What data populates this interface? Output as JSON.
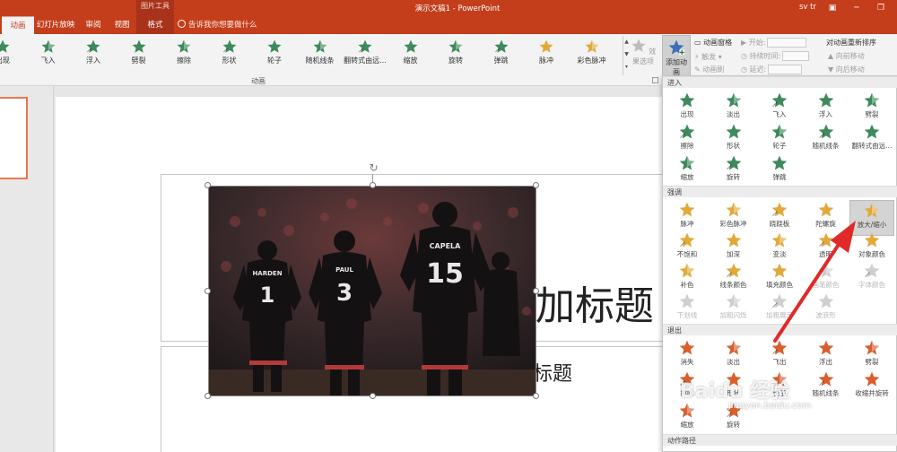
{
  "window": {
    "title": "演示文稿1 - PowerPoint",
    "context_group": "图片工具",
    "user": "sv tr"
  },
  "tabs": [
    {
      "label": "动画",
      "active": true
    },
    {
      "label": "幻灯片放映"
    },
    {
      "label": "审阅"
    },
    {
      "label": "视图"
    },
    {
      "label": "格式",
      "contextual": true
    }
  ],
  "tell_me": "告诉我你想要做什么",
  "ribbon": {
    "gallery": [
      {
        "label": "出现",
        "color": "#3e8a5c"
      },
      {
        "label": "飞入",
        "color": "#3e8a5c"
      },
      {
        "label": "浮入",
        "color": "#3e8a5c"
      },
      {
        "label": "劈裂",
        "color": "#3e8a5c"
      },
      {
        "label": "擦除",
        "color": "#3e8a5c"
      },
      {
        "label": "形状",
        "color": "#3e8a5c"
      },
      {
        "label": "轮子",
        "color": "#3e8a5c"
      },
      {
        "label": "随机线条",
        "color": "#3e8a5c"
      },
      {
        "label": "翻转式由远...",
        "color": "#3e8a5c"
      },
      {
        "label": "缩放",
        "color": "#3e8a5c"
      },
      {
        "label": "旋转",
        "color": "#3e8a5c"
      },
      {
        "label": "弹跳",
        "color": "#3e8a5c"
      },
      {
        "label": "脉冲",
        "color": "#e2a93a"
      },
      {
        "label": "彩色脉冲",
        "color": "#e2a93a"
      }
    ],
    "effect_options": "效果选项",
    "group_label": "动画",
    "add_animation": "添加动画",
    "animation_pane": "动画窗格",
    "trigger": "触发",
    "animation_painter": "动画刷",
    "start": "开始:",
    "duration": "持续时间:",
    "delay": "延迟:",
    "reorder": "对动画重新排序",
    "move_earlier": "向前移动",
    "move_later": "向后移动"
  },
  "slide": {
    "title_text": "加标题",
    "subtitle_text": "标题"
  },
  "panel": {
    "entrance": {
      "header": "进入",
      "items": [
        "出现",
        "淡出",
        "飞入",
        "浮入",
        "劈裂",
        "擦除",
        "形状",
        "轮子",
        "随机线条",
        "翻转式由远...",
        "缩放",
        "旋转",
        "弹跳"
      ],
      "color": "#3e8a5c"
    },
    "emphasis": {
      "header": "强调",
      "items": [
        "脉冲",
        "彩色脉冲",
        "跷跷板",
        "陀螺旋",
        "放大/缩小",
        "不饱和",
        "加深",
        "变淡",
        "透明",
        "对象颜色",
        "补色",
        "线条颜色",
        "填充颜色",
        "画笔颜色",
        "字体颜色",
        "下划线",
        "加粗闪烁",
        "加粗展示",
        "波浪形"
      ],
      "disabled_from": 13,
      "highlighted": 4,
      "color": "#e2a93a"
    },
    "exit": {
      "header": "退出",
      "items": [
        "消失",
        "淡出",
        "飞出",
        "浮出",
        "劈裂",
        "擦除",
        "形状",
        "轮子",
        "随机线条",
        "收缩并旋转",
        "缩放",
        "旋转"
      ],
      "color": "#d9602e"
    },
    "path_header": "动作路径"
  },
  "watermark": {
    "brand": "Baidu 经验",
    "url": "jingyan.baidu.com"
  }
}
